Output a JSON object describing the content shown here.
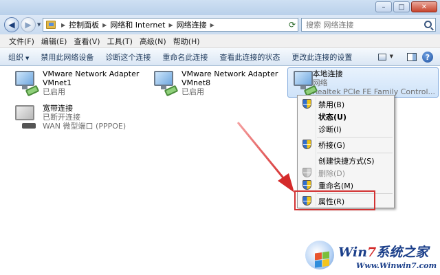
{
  "address": {
    "breadcrumbs": [
      "控制面板",
      "网络和 Internet",
      "网络连接"
    ],
    "search_placeholder": "搜索 网络连接"
  },
  "menubar": [
    "文件(F)",
    "编辑(E)",
    "查看(V)",
    "工具(T)",
    "高级(N)",
    "帮助(H)"
  ],
  "commandbar": {
    "organize": "组织",
    "items": [
      "禁用此网络设备",
      "诊断这个连接",
      "重命名此连接",
      "查看此连接的状态",
      "更改此连接的设置"
    ]
  },
  "connections": [
    {
      "name": "VMware Network Adapter",
      "sub": "VMnet1",
      "status": "已启用"
    },
    {
      "name": "VMware Network Adapter",
      "sub": "VMnet8",
      "status": "已启用"
    },
    {
      "name": "本地连接",
      "sub": "网络",
      "status": "Realtek PCIe FE Family Control..."
    },
    {
      "name": "宽带连接",
      "sub": "已断开连接",
      "status": "WAN 微型端口 (PPPOE)"
    }
  ],
  "context_menu": [
    {
      "label": "禁用(B)",
      "shield": true,
      "bold": false,
      "disabled": false
    },
    {
      "label": "状态(U)",
      "shield": false,
      "bold": true,
      "disabled": false
    },
    {
      "label": "诊断(I)",
      "shield": false,
      "bold": false,
      "disabled": false
    },
    {
      "label": "桥接(G)",
      "shield": true,
      "bold": false,
      "disabled": false
    },
    {
      "label": "创建快捷方式(S)",
      "shield": false,
      "bold": false,
      "disabled": false
    },
    {
      "label": "删除(D)",
      "shield": true,
      "bold": false,
      "disabled": true
    },
    {
      "label": "重命名(M)",
      "shield": true,
      "bold": false,
      "disabled": false
    },
    {
      "label": "属性(R)",
      "shield": true,
      "bold": false,
      "disabled": false
    }
  ],
  "watermark": {
    "brand_prefix": "Win",
    "brand_seven": "7",
    "brand_suffix": "系统之家",
    "site": "Www.Winwin7.com"
  },
  "colors": {
    "highlight": "#d23232",
    "arrow": "#e04040",
    "selection": "#cfe3f9"
  }
}
